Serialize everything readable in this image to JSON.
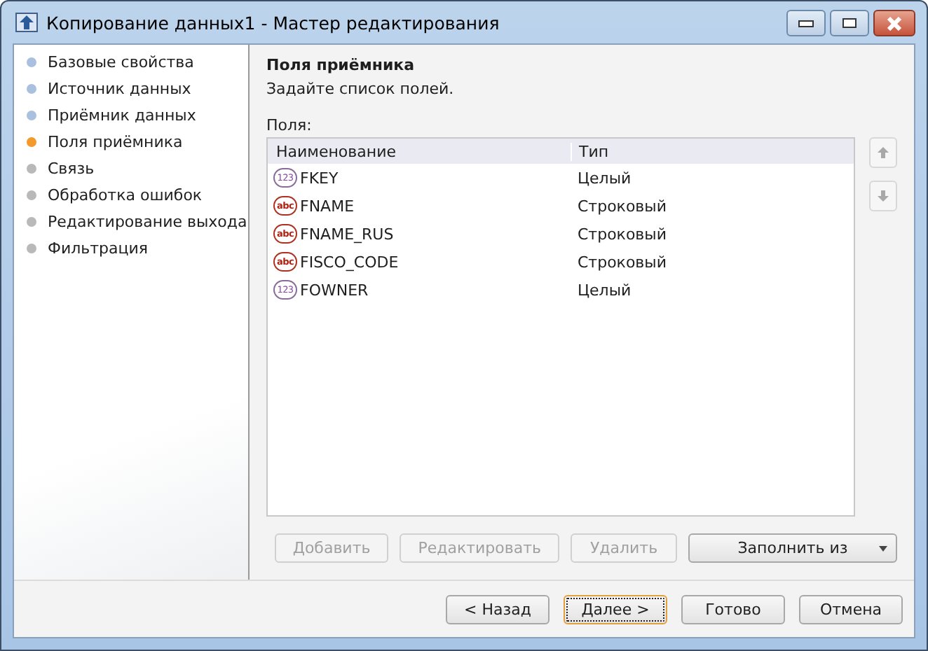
{
  "window": {
    "title": "Копирование данных1 - Мастер редактирования"
  },
  "steps": [
    {
      "label": "Базовые свойства",
      "visited": true,
      "selected": false
    },
    {
      "label": "Источник данных",
      "visited": true,
      "selected": false
    },
    {
      "label": "Приёмник данных",
      "visited": true,
      "selected": false
    },
    {
      "label": "Поля приёмника",
      "selected": true
    },
    {
      "label": "Связь",
      "visited": false,
      "selected": false
    },
    {
      "label": "Обработка ошибок",
      "visited": false,
      "selected": false
    },
    {
      "label": "Редактирование выхода",
      "visited": false,
      "selected": false
    },
    {
      "label": "Фильтрация",
      "visited": false,
      "selected": false
    }
  ],
  "page": {
    "title": "Поля приёмника",
    "subtitle": "Задайте список полей.",
    "list_label": "Поля:"
  },
  "table": {
    "columns": [
      "Наименование",
      "Тип"
    ],
    "rows": [
      {
        "kind": "integer",
        "badge": "123",
        "name": "FKEY",
        "type": "Целый"
      },
      {
        "kind": "string",
        "badge": "abc",
        "name": "FNAME",
        "type": "Строковый"
      },
      {
        "kind": "string",
        "badge": "abc",
        "name": "FNAME_RUS",
        "type": "Строковый"
      },
      {
        "kind": "string",
        "badge": "abc",
        "name": "FISCO_CODE",
        "type": "Строковый"
      },
      {
        "kind": "integer",
        "badge": "123",
        "name": "FOWNER",
        "type": "Целый"
      }
    ]
  },
  "move_buttons": [
    {
      "kind": "up",
      "disabled": true
    },
    {
      "kind": "down",
      "disabled": true
    }
  ],
  "list_buttons": [
    {
      "label": "Добавить",
      "disabled": true,
      "dropdown": false
    },
    {
      "label": "Редактировать",
      "disabled": true,
      "dropdown": false
    },
    {
      "label": "Удалить",
      "disabled": true,
      "dropdown": false
    },
    {
      "label": "Заполнить из",
      "disabled": false,
      "dropdown": true
    }
  ],
  "nav_buttons": [
    {
      "label": "< Назад",
      "focused": false
    },
    {
      "label": "Далее >",
      "focused": true
    },
    {
      "label": "Готово",
      "focused": false
    },
    {
      "label": "Отмена",
      "focused": false
    }
  ]
}
